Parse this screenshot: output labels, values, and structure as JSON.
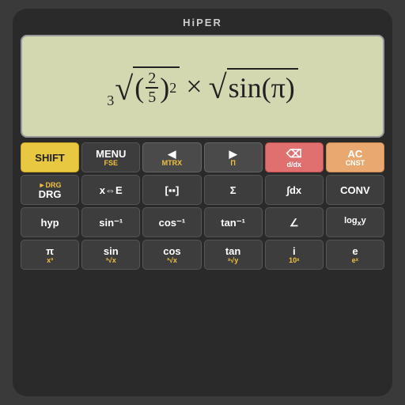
{
  "app": {
    "title": "HiPER"
  },
  "display": {
    "expression": "³√(2/5)² × √sin(π)"
  },
  "rows": [
    {
      "id": "row1",
      "buttons": [
        {
          "id": "shift",
          "main": "SHIFT",
          "sub": "",
          "style": "shift"
        },
        {
          "id": "menu",
          "main": "MENU",
          "sub": "FSE",
          "style": "menu"
        },
        {
          "id": "left",
          "main": "◀",
          "sub": "MTRX",
          "style": "nav"
        },
        {
          "id": "right",
          "main": "▶",
          "sub": "Π",
          "style": "nav"
        },
        {
          "id": "delete",
          "main": "⌫",
          "sub": "d/dx",
          "style": "delete"
        },
        {
          "id": "ac",
          "main": "AC",
          "sub": "CNST",
          "style": "ac"
        }
      ]
    },
    {
      "id": "row2",
      "buttons": [
        {
          "id": "drg",
          "main": "DRG",
          "sub": "►DRG",
          "style": "dark"
        },
        {
          "id": "xce",
          "main": "x⇔E",
          "sub": "",
          "style": "dark"
        },
        {
          "id": "matrix",
          "main": "[╔╗]",
          "sub": "",
          "style": "dark"
        },
        {
          "id": "sigma",
          "main": "Σ",
          "sub": "",
          "style": "dark"
        },
        {
          "id": "integral",
          "main": "∫dx",
          "sub": "",
          "style": "dark"
        },
        {
          "id": "conv",
          "main": "CONV",
          "sub": "",
          "style": "dark"
        }
      ]
    },
    {
      "id": "row3",
      "buttons": [
        {
          "id": "hyp",
          "main": "hyp",
          "sub": "",
          "style": "dark"
        },
        {
          "id": "sin-inv",
          "main": "sin⁻¹",
          "sub": "",
          "style": "dark"
        },
        {
          "id": "cos-inv",
          "main": "cos⁻¹",
          "sub": "",
          "style": "dark"
        },
        {
          "id": "tan-inv",
          "main": "tan⁻¹",
          "sub": "",
          "style": "dark"
        },
        {
          "id": "angle",
          "main": "∠",
          "sub": "",
          "style": "dark"
        },
        {
          "id": "logy",
          "main": "logₓy",
          "sub": "",
          "style": "dark"
        }
      ]
    },
    {
      "id": "row4",
      "buttons": [
        {
          "id": "pi",
          "main": "π",
          "sub": "x³",
          "style": "dark"
        },
        {
          "id": "sin",
          "main": "sin",
          "sub": "",
          "style": "dark"
        },
        {
          "id": "cos",
          "main": "cos",
          "sub": "",
          "style": "dark"
        },
        {
          "id": "tan",
          "main": "tan",
          "sub": "",
          "style": "dark"
        },
        {
          "id": "i",
          "main": "i",
          "sub": "",
          "style": "dark"
        },
        {
          "id": "e",
          "main": "e",
          "sub": "",
          "style": "dark"
        }
      ]
    },
    {
      "id": "row5-sub",
      "labels": [
        "",
        "x³",
        "³√x",
        "ˣ√y",
        "10ˣ",
        "eˣ"
      ]
    }
  ]
}
